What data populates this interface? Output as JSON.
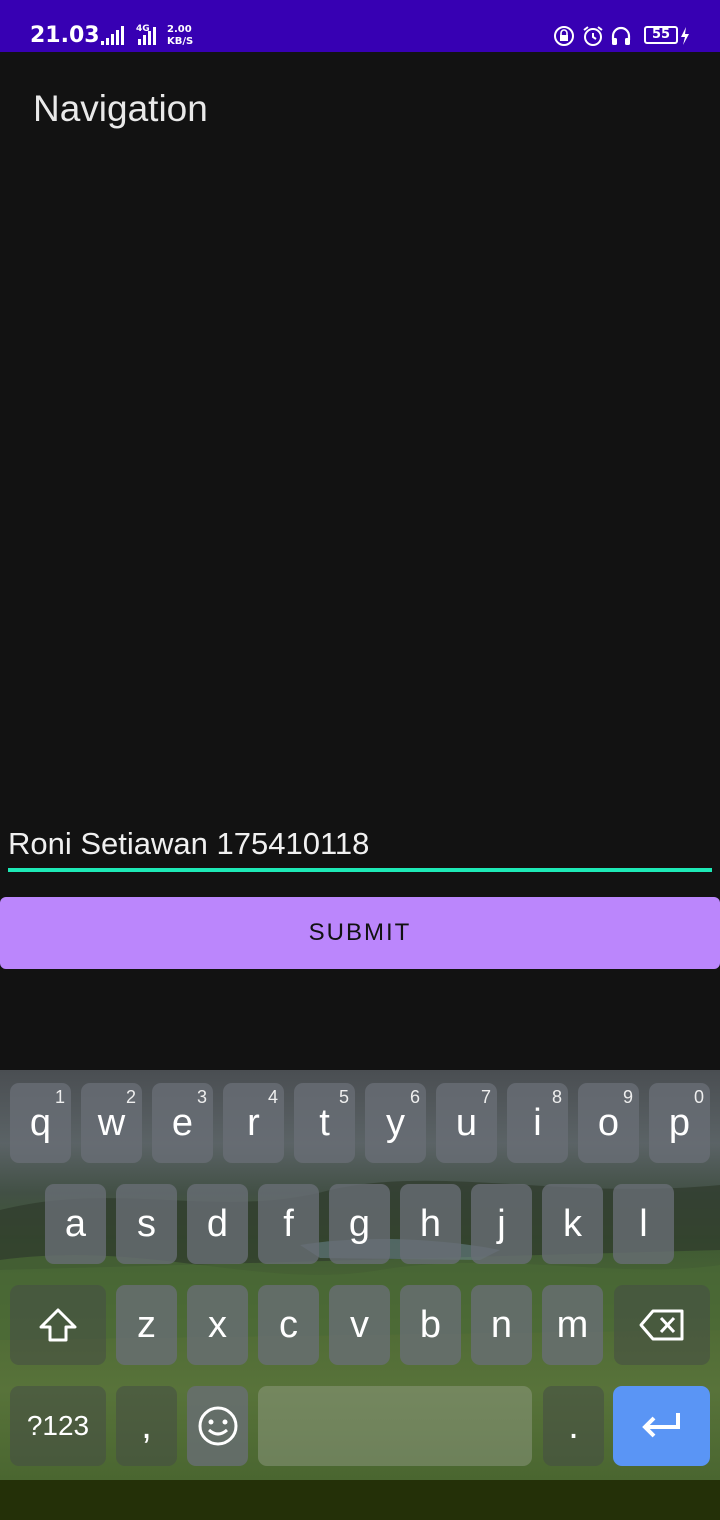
{
  "status_bar": {
    "time": "21.03",
    "network_type": "4G",
    "speed_value": "2.00",
    "speed_unit": "KB/S",
    "battery_level": "55"
  },
  "app": {
    "title": "Navigation"
  },
  "form": {
    "input_value": "Roni Setiawan 175410118",
    "submit_label": "SUBMIT"
  },
  "keyboard": {
    "row1": [
      {
        "key": "q",
        "hint": "1"
      },
      {
        "key": "w",
        "hint": "2"
      },
      {
        "key": "e",
        "hint": "3"
      },
      {
        "key": "r",
        "hint": "4"
      },
      {
        "key": "t",
        "hint": "5"
      },
      {
        "key": "y",
        "hint": "6"
      },
      {
        "key": "u",
        "hint": "7"
      },
      {
        "key": "i",
        "hint": "8"
      },
      {
        "key": "o",
        "hint": "9"
      },
      {
        "key": "p",
        "hint": "0"
      }
    ],
    "row2": [
      "a",
      "s",
      "d",
      "f",
      "g",
      "h",
      "j",
      "k",
      "l"
    ],
    "row3": [
      "z",
      "x",
      "c",
      "v",
      "b",
      "n",
      "m"
    ],
    "symbols_label": "?123",
    "comma": ",",
    "period": ".",
    "icons": {
      "shift": "shift-icon",
      "backspace": "backspace-icon",
      "emoji": "emoji-icon",
      "enter": "enter-icon"
    },
    "enter_color": "#5a95f5"
  },
  "colors": {
    "status_bar": "#3700b3",
    "accent": "#1de9b6",
    "button": "#bb86fc"
  }
}
